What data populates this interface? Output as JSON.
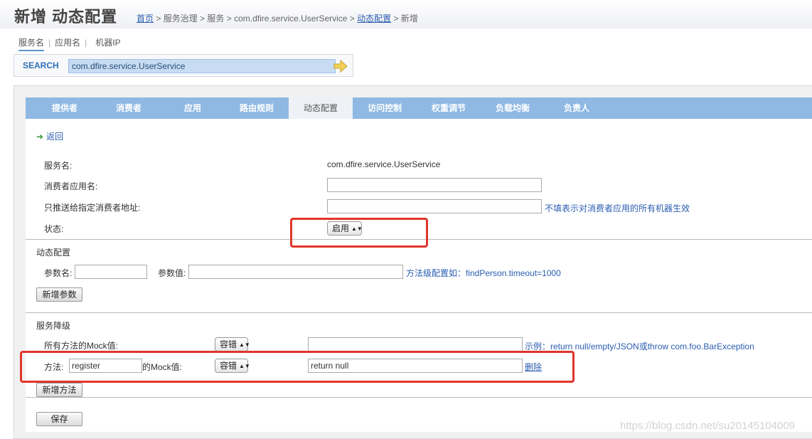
{
  "page": {
    "title": "新增 动态配置",
    "breadcrumb": {
      "home": "首页",
      "sep1": " > ",
      "governance": "服务治理",
      "sep2": " > ",
      "service": "服务",
      "sep3": " > ",
      "service_name": "com.dfire.service.UserService",
      "sep4": " > ",
      "dynamic_config": "动态配置",
      "sep5": " > ",
      "current": "新增"
    }
  },
  "search": {
    "tabs": [
      "服务名",
      "应用名",
      "机器IP"
    ],
    "separator": "|",
    "label": "SEARCH",
    "value": "com.dfire.service.UserService"
  },
  "nav": {
    "tabs": [
      "提供者",
      "消费者",
      "应用",
      "路由规则",
      "动态配置",
      "访问控制",
      "权重调节",
      "负载均衡",
      "负责人"
    ],
    "active": "动态配置"
  },
  "form": {
    "back_label": "返回",
    "service_label": "服务名:",
    "service_value": "com.dfire.service.UserService",
    "consumer_app_label": "消费者应用名:",
    "consumer_app_value": "",
    "consumer_addr_label": "只推送给指定消费者地址:",
    "consumer_addr_value": "",
    "consumer_addr_hint": "不填表示对消费者应用的所有机器生效",
    "status_label": "状态:",
    "status_value": "启用"
  },
  "dynamic": {
    "title": "动态配置",
    "param_name_label": "参数名:",
    "param_name_value": "",
    "param_value_label": "参数值:",
    "param_value_value": "",
    "hint": "方法级配置如：findPerson.timeout=1000",
    "add_param_button": "新增参数"
  },
  "degrade": {
    "title": "服务降级",
    "all_methods_label": "所有方法的Mock值:",
    "all_methods_mode": "容错",
    "all_methods_value": "",
    "example_hint": "示例：return null/empty/JSON或throw com.foo.BarException",
    "method_label": "方法:",
    "method_name": "register",
    "method_mock_label": "的Mock值:",
    "method_mode": "容错",
    "method_value": "return null",
    "delete_link": "删除",
    "add_method_button": "新增方法",
    "save_button": "保存"
  },
  "watermark": "https://blog.csdn.net/su20145104009",
  "colors": {
    "nav_bg": "#8fb8e3",
    "link": "#2a5db0",
    "highlight_box": "#e0352b"
  }
}
